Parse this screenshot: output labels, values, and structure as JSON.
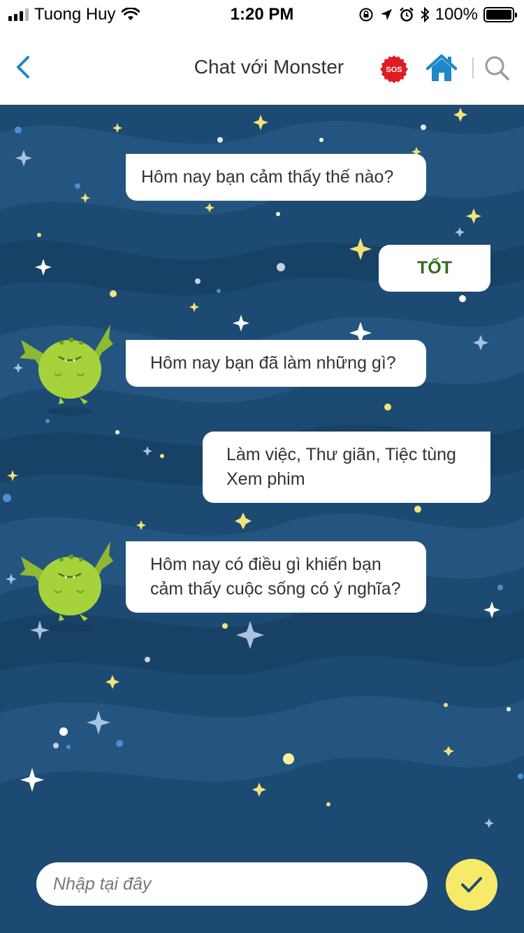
{
  "status_bar": {
    "carrier": "Tuong Huy",
    "time": "1:20 PM",
    "battery": "100%"
  },
  "nav": {
    "title": "Chat với Monster",
    "sos_label": "SOS",
    "icons": [
      "chevron-left-icon",
      "sos-icon",
      "home-icon",
      "search-icon"
    ]
  },
  "messages": [
    {
      "from": "bot",
      "text": "Hôm nay bạn cảm thấy thế nào?"
    },
    {
      "from": "user",
      "text": "TỐT"
    },
    {
      "from": "bot",
      "text": "Hôm nay bạn đã làm những gì?"
    },
    {
      "from": "user",
      "lines": [
        "Làm việc, Thư giãn, Tiệc tùng",
        "Xem phim"
      ]
    },
    {
      "from": "bot",
      "lines": [
        "Hôm nay có điều gì khiến bạn",
        "cảm thấy cuộc sống có ý nghĩa?"
      ]
    }
  ],
  "input": {
    "placeholder": "Nhập tại đây"
  },
  "colors": {
    "chat_background": "#1d4a72",
    "accent_blue": "#1e88c8",
    "sos_red": "#e01b22",
    "send_yellow": "#f7ea6a",
    "user_reply_green": "#2f6b1e",
    "monster_green": "#a6d23c"
  }
}
